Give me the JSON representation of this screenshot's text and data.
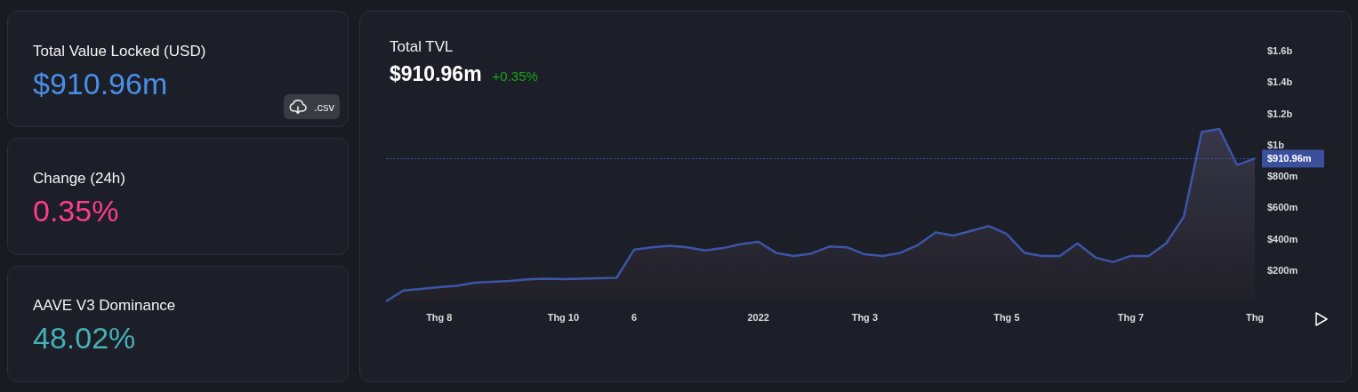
{
  "stats": [
    {
      "label": "Total Value Locked (USD)",
      "value": "$910.96m",
      "color": "#4a8fe7",
      "download": {
        "label": ".csv"
      }
    },
    {
      "label": "Change (24h)",
      "value": "0.35%",
      "color": "#ff3d8b"
    },
    {
      "label": "AAVE V3 Dominance",
      "value": "48.02%",
      "color": "#45b0b6"
    }
  ],
  "chart_panel": {
    "title": "Total TVL",
    "value": "$910.96m",
    "change": "+0.35%",
    "chart_data": {
      "type": "area",
      "ylim": [
        0,
        1600000000
      ],
      "yticks": [
        {
          "value": 200000000,
          "label": "$200m"
        },
        {
          "value": 400000000,
          "label": "$400m"
        },
        {
          "value": 600000000,
          "label": "$600m"
        },
        {
          "value": 800000000,
          "label": "$800m"
        },
        {
          "value": 1000000000,
          "label": "$1b"
        },
        {
          "value": 1200000000,
          "label": "$1.2b"
        },
        {
          "value": 1400000000,
          "label": "$1.4b"
        },
        {
          "value": 1600000000,
          "label": "$1.6b"
        }
      ],
      "categories": [
        null,
        null,
        null,
        "Thg 8",
        null,
        null,
        null,
        null,
        null,
        null,
        "Thg 10",
        null,
        null,
        null,
        "6",
        null,
        null,
        null,
        null,
        null,
        null,
        "2022",
        null,
        null,
        null,
        null,
        null,
        "Thg 3",
        null,
        null,
        null,
        null,
        null,
        null,
        null,
        "Thg 5",
        null,
        null,
        null,
        null,
        null,
        null,
        "Thg 7",
        null,
        null,
        null,
        null,
        null,
        null,
        "Thg"
      ],
      "series": [
        {
          "color": "#3d55a8",
          "values": [
            0,
            70000000,
            80000000,
            90000000,
            100000000,
            120000000,
            125000000,
            130000000,
            140000000,
            145000000,
            142000000,
            145000000,
            147000000,
            150000000,
            330000000,
            345000000,
            355000000,
            345000000,
            325000000,
            340000000,
            365000000,
            380000000,
            310000000,
            290000000,
            305000000,
            350000000,
            345000000,
            300000000,
            290000000,
            310000000,
            360000000,
            440000000,
            420000000,
            450000000,
            480000000,
            430000000,
            310000000,
            290000000,
            290000000,
            370000000,
            280000000,
            250000000,
            290000000,
            290000000,
            370000000,
            540000000,
            1080000000,
            1100000000,
            870000000,
            911000000
          ]
        }
      ],
      "ref_lines": [
        {
          "axis": "y",
          "value": 910960000,
          "label": "$910.96m"
        }
      ]
    }
  }
}
